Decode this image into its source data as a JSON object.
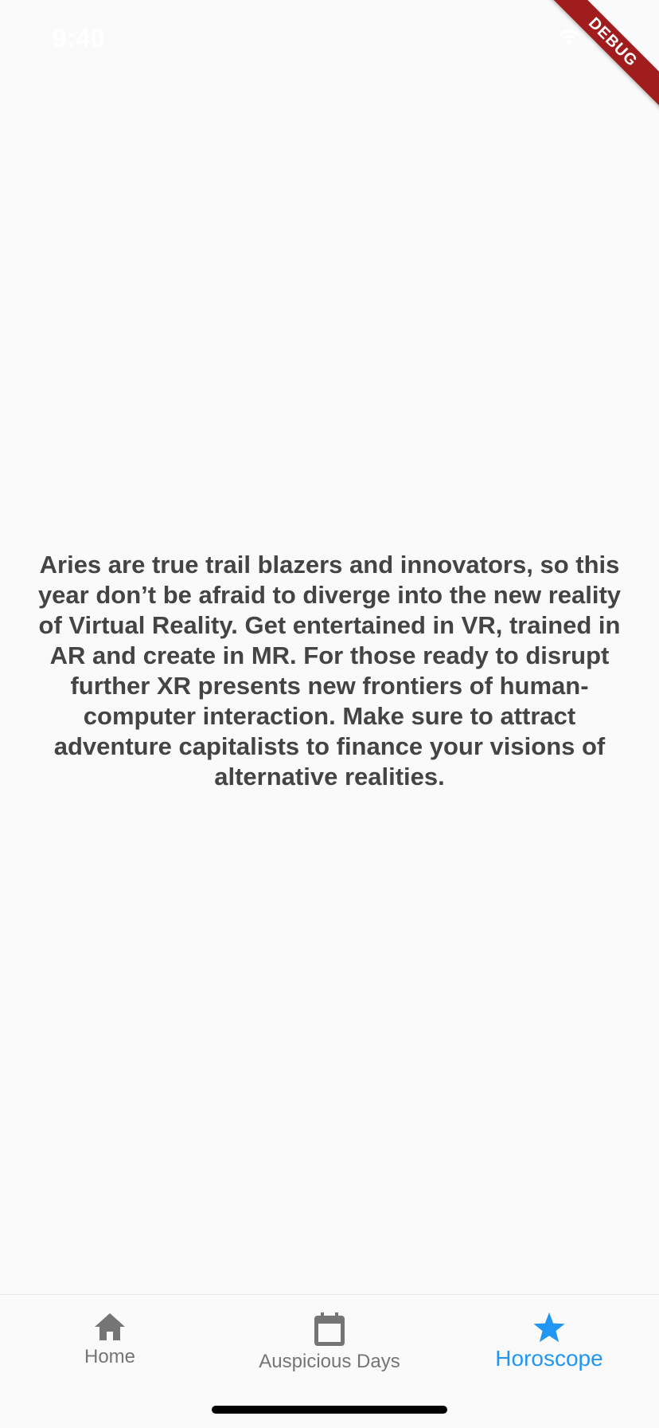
{
  "status_bar": {
    "time": "9:40"
  },
  "debug_banner": {
    "label": "DEBUG"
  },
  "horoscope": {
    "text": "Aries are true trail blazers and innovators, so this year don’t be afraid to diverge into the new reality of Virtual Reality. Get entertained in VR, trained in AR and create in MR. For those ready to disrupt further XR presents new frontiers of human-computer interaction. Make sure to attract adventure capitalists to finance your visions of alternative realities."
  },
  "bottom_nav": {
    "items": [
      {
        "label": "Home",
        "icon": "home-icon",
        "active": false
      },
      {
        "label": "Auspicious Days",
        "icon": "calendar-icon",
        "active": false
      },
      {
        "label": "Horoscope",
        "icon": "star-icon",
        "active": true
      }
    ]
  },
  "colors": {
    "background": "#fafafa",
    "text": "#444444",
    "inactive": "#757575",
    "accent": "#2196f3",
    "debug": "#a11d1d"
  }
}
